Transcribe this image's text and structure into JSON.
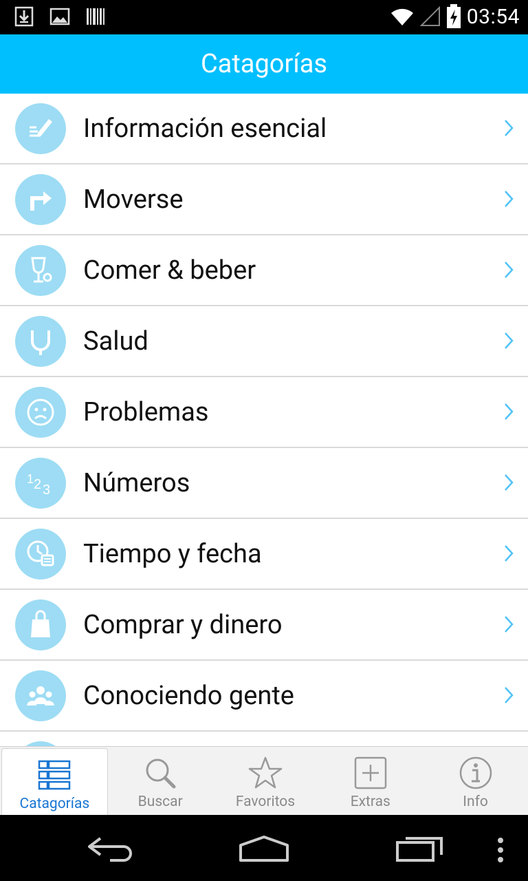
{
  "status_bar": {
    "time": "03:54",
    "left_icons": [
      "download-icon",
      "image-icon",
      "barcode-icon"
    ],
    "right_icons": [
      "wifi-icon",
      "signal-icon",
      "battery-charging-icon"
    ]
  },
  "appbar": {
    "title": "Catagorías"
  },
  "categories": [
    {
      "label": "Información esencial",
      "icon": "pencil-note-icon"
    },
    {
      "label": "Moverse",
      "icon": "turn-right-arrow-icon"
    },
    {
      "label": "Comer & beber",
      "icon": "glass-icon"
    },
    {
      "label": "Salud",
      "icon": "stethoscope-icon"
    },
    {
      "label": "Problemas",
      "icon": "sad-face-icon"
    },
    {
      "label": "Números",
      "icon": "numbers-123-icon"
    },
    {
      "label": "Tiempo y fecha",
      "icon": "clock-calendar-icon"
    },
    {
      "label": "Comprar y dinero",
      "icon": "shopping-bag-icon"
    },
    {
      "label": "Conociendo gente",
      "icon": "people-group-icon"
    }
  ],
  "tabs": [
    {
      "label": "Catagorías",
      "icon": "list-icon",
      "active": true
    },
    {
      "label": "Buscar",
      "icon": "search-icon",
      "active": false
    },
    {
      "label": "Favoritos",
      "icon": "star-icon",
      "active": false
    },
    {
      "label": "Extras",
      "icon": "plus-box-icon",
      "active": false
    },
    {
      "label": "Info",
      "icon": "info-icon",
      "active": false
    }
  ],
  "colors": {
    "accent": "#00BFFF",
    "icon_circle": "#9DDCF4",
    "active_tab": "#1976D2"
  },
  "nav_bar": [
    "back-icon",
    "home-icon",
    "recent-apps-icon",
    "overflow-menu-icon"
  ]
}
